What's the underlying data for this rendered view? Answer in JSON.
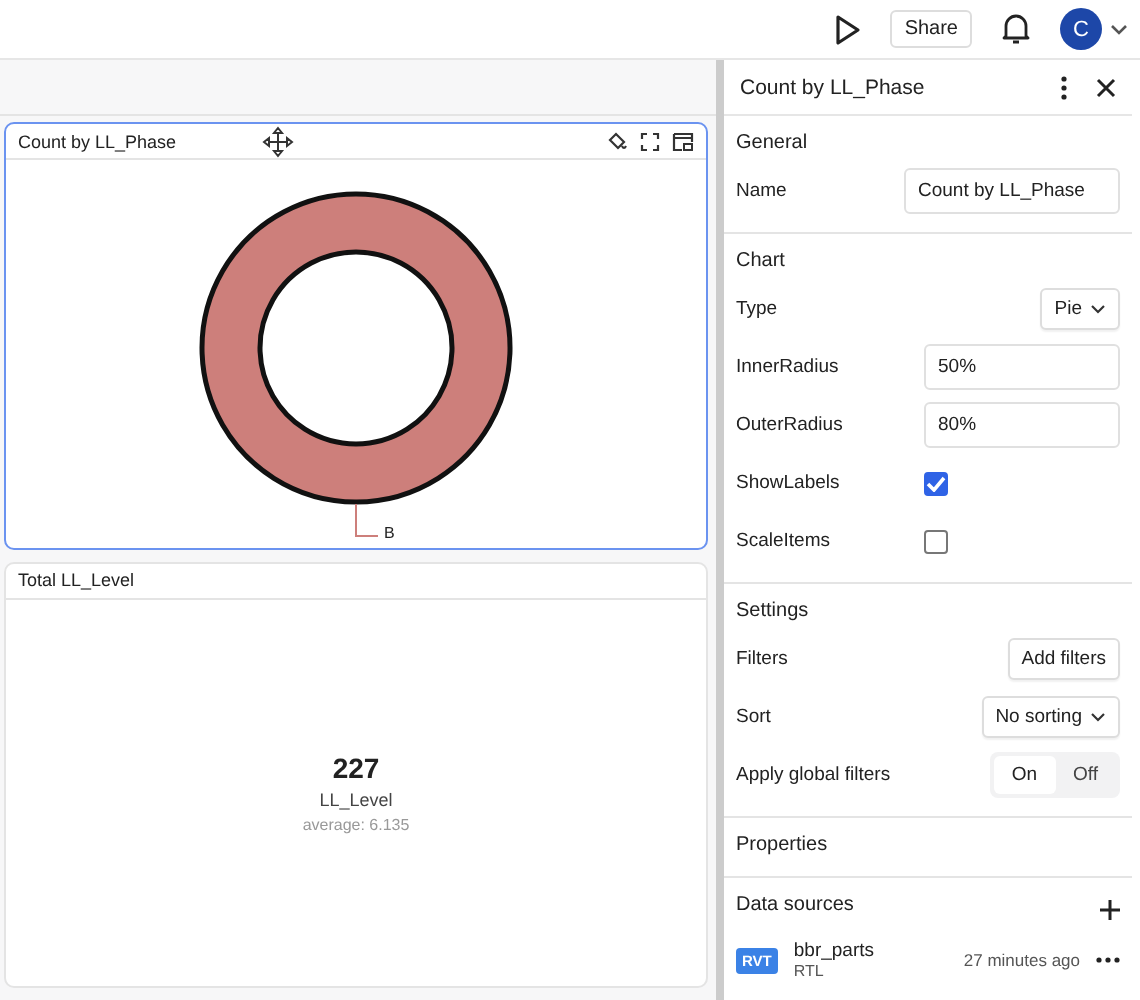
{
  "topbar": {
    "share": "Share",
    "avatar": "C"
  },
  "cards": [
    {
      "kind": "donut",
      "title": "Count by LL_Phase",
      "selected": true,
      "slice_label": "B"
    },
    {
      "kind": "kpi",
      "title": "Total LL_Level",
      "selected": false,
      "value": "227",
      "label": "LL_Level",
      "sub": "average: 6.135"
    }
  ],
  "panel": {
    "title": "Count by LL_Phase",
    "general": {
      "heading": "General",
      "name_label": "Name",
      "name_value": "Count by LL_Phase"
    },
    "chart": {
      "heading": "Chart",
      "rows": [
        {
          "kind": "select",
          "label": "Type",
          "value": "Pie"
        },
        {
          "kind": "input",
          "label": "InnerRadius",
          "value": "50%"
        },
        {
          "kind": "input",
          "label": "OuterRadius",
          "value": "80%"
        },
        {
          "kind": "checkbox",
          "label": "ShowLabels",
          "checked": true
        },
        {
          "kind": "checkbox",
          "label": "ScaleItems",
          "checked": false
        }
      ]
    },
    "settings": {
      "heading": "Settings",
      "rows": [
        {
          "kind": "button",
          "label": "Filters",
          "value": "Add filters"
        },
        {
          "kind": "select",
          "label": "Sort",
          "value": "No sorting"
        },
        {
          "kind": "toggle",
          "label": "Apply global filters",
          "options": [
            {
              "label": "On",
              "selected": true
            },
            {
              "label": "Off",
              "selected": false
            }
          ]
        }
      ]
    },
    "properties": {
      "heading": "Properties"
    },
    "sources": {
      "heading": "Data sources",
      "items": [
        {
          "badge": "RVT",
          "name": "bbr_parts",
          "sub": "RTL",
          "time": "27 minutes ago"
        }
      ]
    }
  }
}
